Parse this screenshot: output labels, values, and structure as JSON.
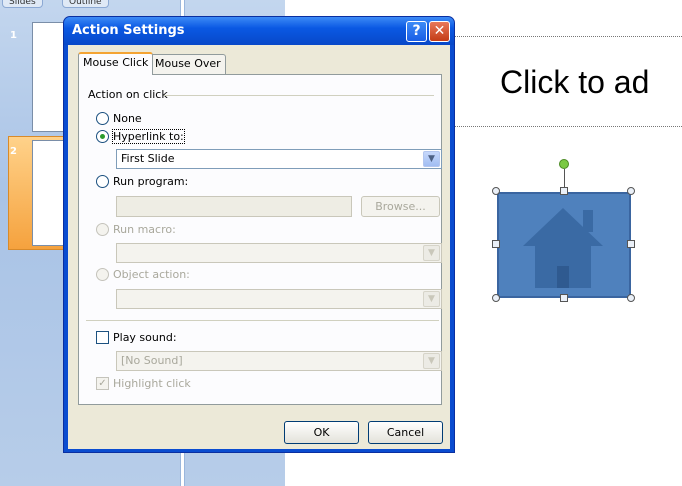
{
  "background": {
    "pane_tabs": [
      "Slides",
      "Outline"
    ],
    "slide_numbers": [
      "1",
      "2"
    ],
    "title_placeholder": "Click to ad"
  },
  "dialog": {
    "title": "Action Settings",
    "help_glyph": "?",
    "close_glyph": "✕",
    "tabs": [
      "Mouse Click",
      "Mouse Over"
    ],
    "group_label": "Action on click",
    "options": {
      "none": "None",
      "hyperlink": "Hyperlink to:",
      "run_program": "Run program:",
      "run_macro": "Run macro:",
      "object_action": "Object action:"
    },
    "hyperlink_value": "First Slide",
    "browse_label": "Browse...",
    "play_sound_label": "Play sound:",
    "sound_value": "[No Sound]",
    "highlight_label": "Highlight click",
    "ok_label": "OK",
    "cancel_label": "Cancel",
    "dropdown_glyph": "▼",
    "check_glyph": "✓"
  },
  "colors": {
    "titlebar": "#0a58e3",
    "shape_fill": "#4f81bd",
    "selected_thumb": "#f5a23e"
  },
  "icons": {
    "shape": "house-icon"
  }
}
